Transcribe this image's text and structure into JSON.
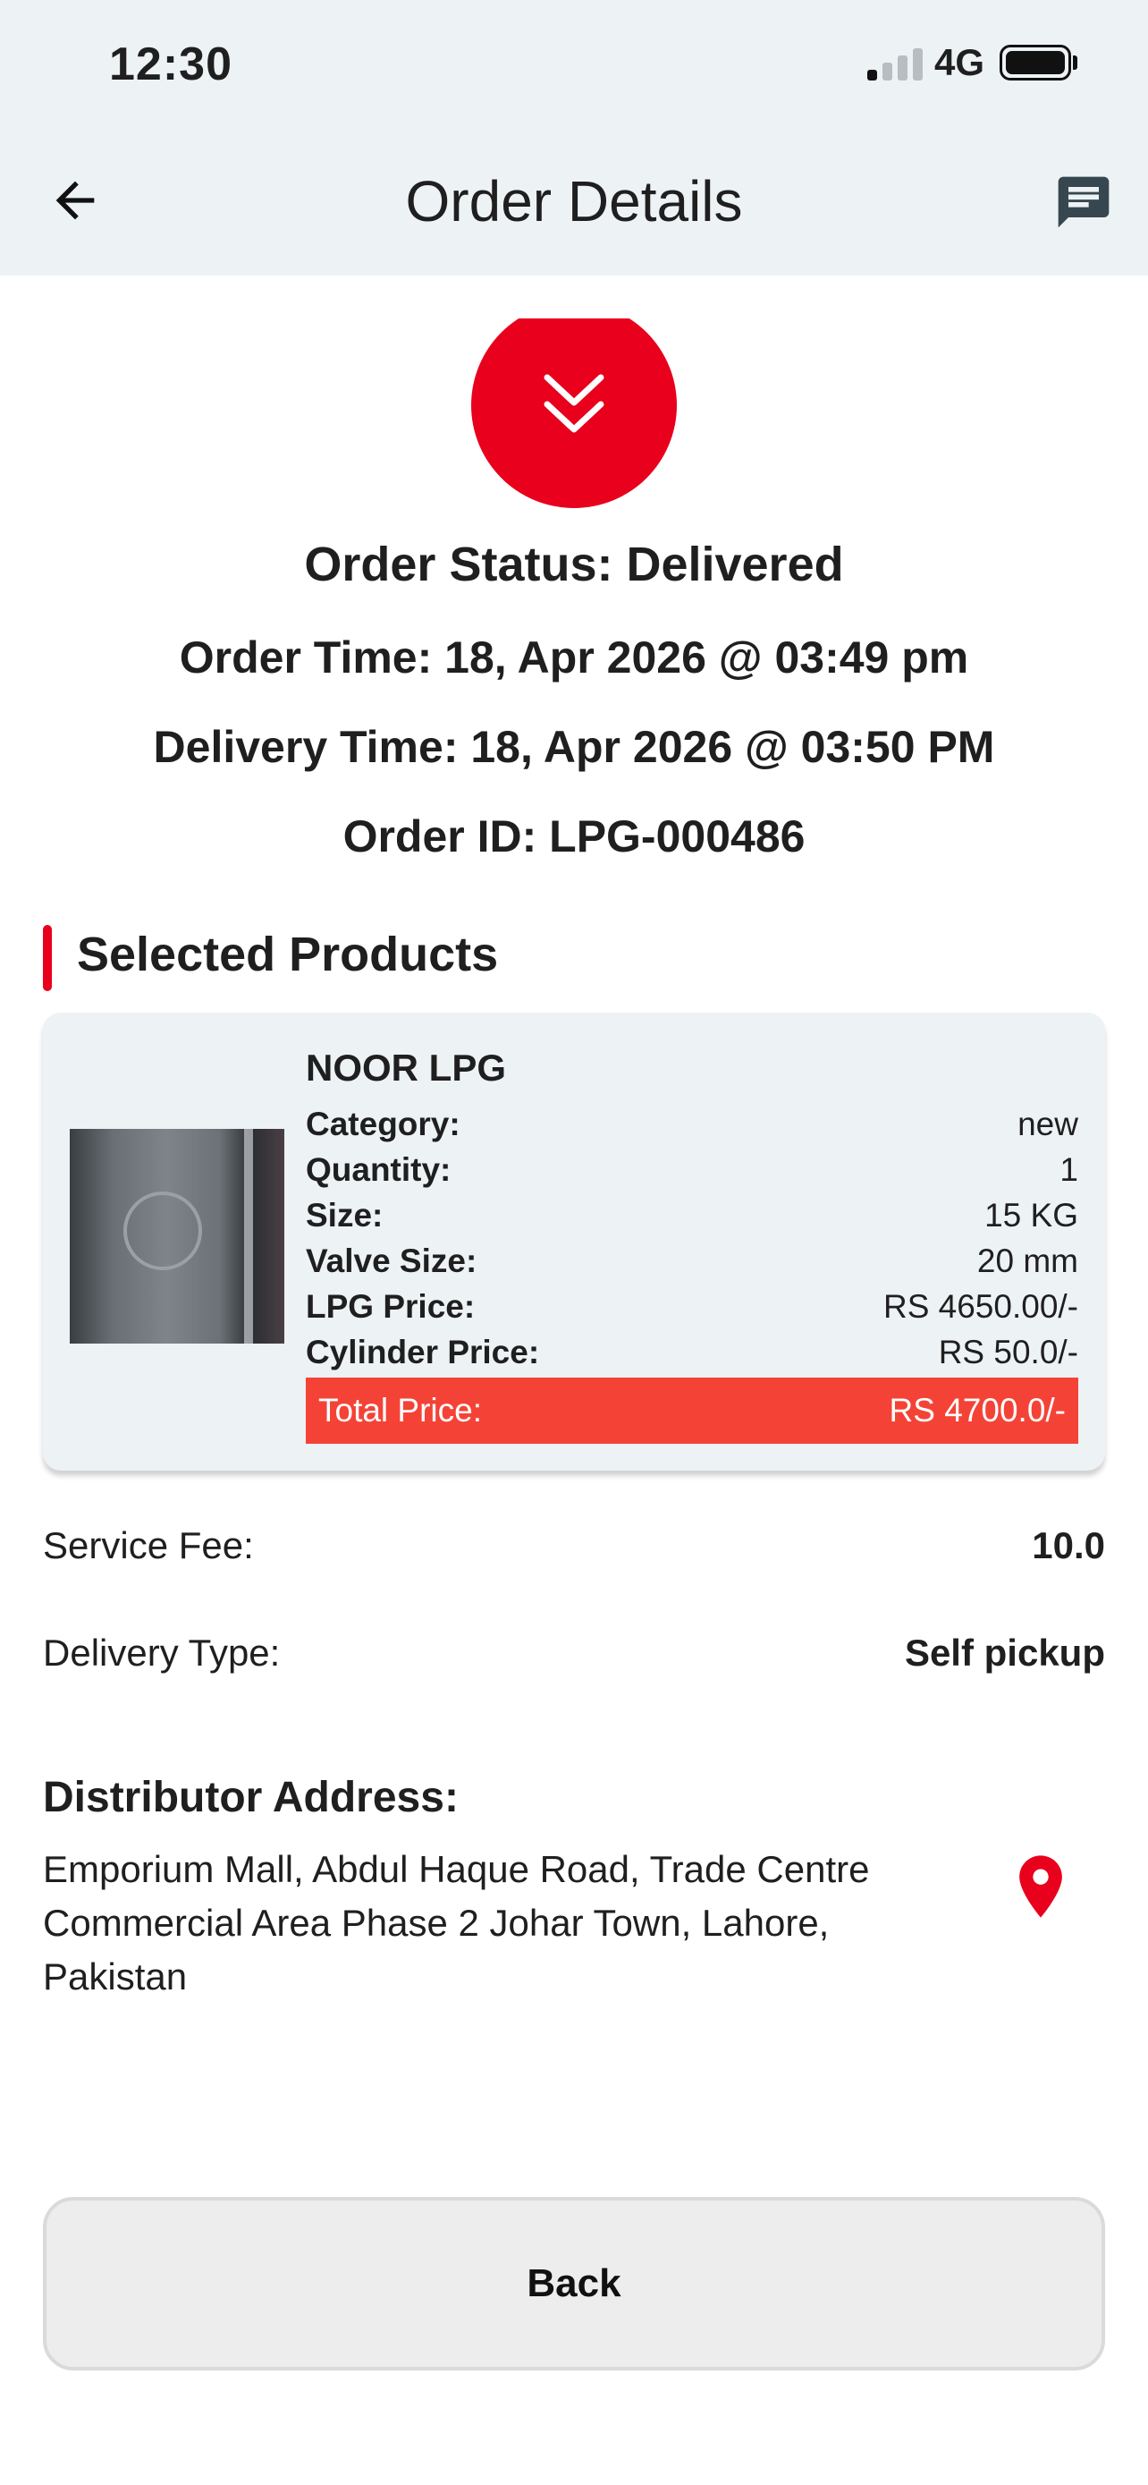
{
  "status_bar": {
    "time": "12:30",
    "network": "4G"
  },
  "app_bar": {
    "title": "Order Details",
    "back_icon": "arrow-left-icon",
    "action_icon": "chat-icon"
  },
  "order": {
    "status": "Order Status: Delivered",
    "order_time": "Order Time: 18, Apr 2026 @ 03:49 pm",
    "delivery_time": "Delivery Time: 18, Apr 2026 @ 03:50 PM",
    "order_id": "Order ID: LPG-000486",
    "status_icon": "double-chevron-down-icon"
  },
  "section": {
    "title": "Selected Products"
  },
  "product": {
    "name": "NOOR LPG",
    "rows": [
      {
        "label": "Category:",
        "value": "new"
      },
      {
        "label": "Quantity:",
        "value": "1"
      },
      {
        "label": "Size:",
        "value": "15 KG"
      },
      {
        "label": "Valve Size:",
        "value": "20 mm"
      },
      {
        "label": "LPG Price:",
        "value": "RS 4650.00/-"
      },
      {
        "label": "Cylinder Price:",
        "value": "RS 50.0/-"
      }
    ],
    "total_label": "Total Price:",
    "total_value": "RS 4700.0/-"
  },
  "fees": {
    "service_fee_label": "Service Fee:",
    "service_fee_value": "10.0",
    "delivery_type_label": "Delivery Type:",
    "delivery_type_value": "Self pickup"
  },
  "address": {
    "title": "Distributor Address:",
    "text": "Emporium Mall, Abdul Haque Road, Trade Centre Commercial Area Phase 2 Johar Town, Lahore, Pakistan",
    "icon": "location-pin-icon"
  },
  "actions": {
    "back_label": "Back"
  },
  "colors": {
    "accent": "#e8001c",
    "total_bg": "#f44336",
    "card_bg": "#edf2f5",
    "header_bg": "#edf2f5"
  }
}
